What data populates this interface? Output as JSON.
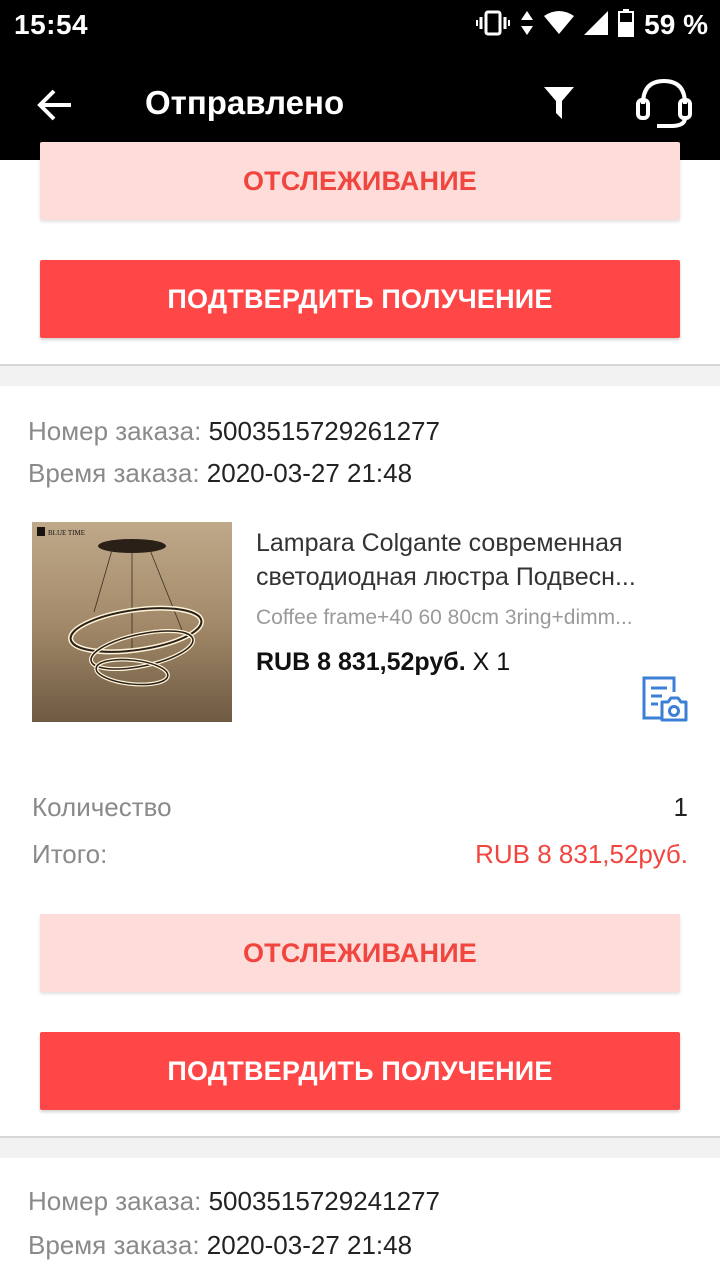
{
  "status_bar": {
    "time": "15:54",
    "battery_percent": "59 %",
    "icons": [
      "vibrate-icon",
      "data-arrows-icon",
      "wifi-icon",
      "signal-icon",
      "battery-icon"
    ]
  },
  "app_bar": {
    "title": "Отправлено",
    "icons": [
      "back-arrow-icon",
      "filter-icon",
      "headset-icon"
    ]
  },
  "orders": [
    {
      "track_label": "ОТСЛЕЖИВАНИЕ",
      "confirm_label": "ПОДТВЕРДИТЬ ПОЛУЧЕНИЕ"
    },
    {
      "order_number_label": "Номер заказа:",
      "order_number": "5003515729261277",
      "order_time_label": "Время заказа:",
      "order_time": "2020-03-27 21:48",
      "product": {
        "image_brand": "BLUE TIME",
        "name_line1": "Lampara Colgante современная",
        "name_line2": "светодиодная люстра Подвесн...",
        "variant": "Coffee frame+40 60 80cm 3ring+dimm...",
        "price": "RUB 8 831,52руб.",
        "qty_text": "X 1"
      },
      "quantity_label": "Количество",
      "quantity_value": "1",
      "total_label": "Итого:",
      "total_value": "RUB 8 831,52руб.",
      "track_label": "ОТСЛЕЖИВАНИЕ",
      "confirm_label": "ПОДТВЕРДИТЬ ПОЛУЧЕНИЕ"
    },
    {
      "order_number_label": "Номер заказа:",
      "order_number": "5003515729241277",
      "order_time_label": "Время заказа:",
      "order_time": "2020-03-27 21:48"
    }
  ],
  "colors": {
    "accent": "#ff4747",
    "accent_light": "#fddcd9",
    "accent_text": "#f0463f",
    "header_bg": "#000000",
    "icon_blue": "#3b7fd6"
  }
}
